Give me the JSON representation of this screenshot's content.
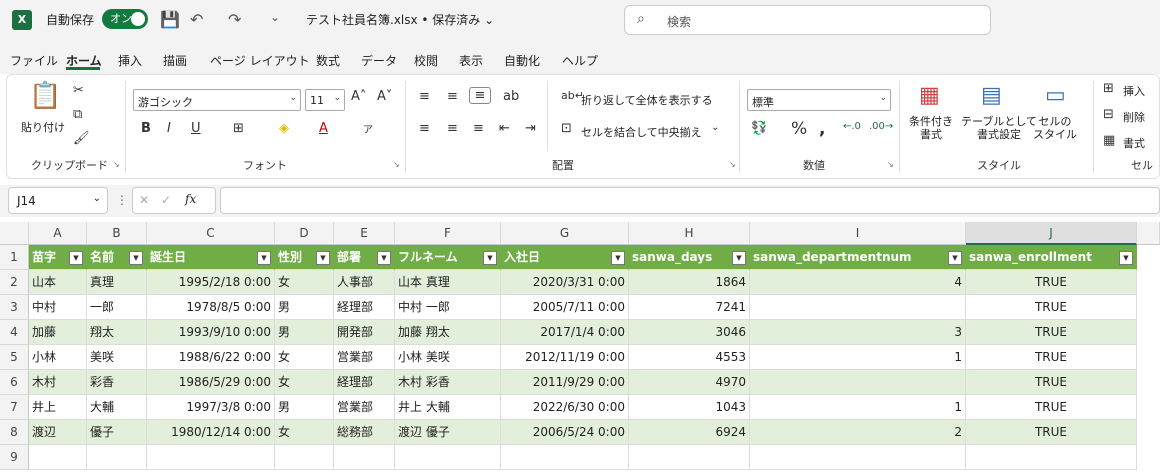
{
  "window": {
    "autosave_label": "自動保存",
    "autosave_state": "オン",
    "filename": "テスト社員名簿.xlsx • 保存済み ⌄",
    "search_placeholder": "検索",
    "app_icon": "X"
  },
  "menu": [
    "ファイル",
    "ホーム",
    "挿入",
    "描画",
    "ページ レイアウト",
    "数式",
    "データ",
    "校閲",
    "表示",
    "自動化",
    "ヘルプ"
  ],
  "ribbon": {
    "clipboard": {
      "label": "クリップボード",
      "paste": "貼り付け"
    },
    "font": {
      "label": "フォント",
      "name": "游ゴシック",
      "size": "11"
    },
    "alignment": {
      "label": "配置",
      "wrap": "折り返して全体を表示する",
      "merge": "セルを結合して中央揃え"
    },
    "number": {
      "label": "数値",
      "format": "標準"
    },
    "styles": {
      "label": "スタイル",
      "conditional": "条件付き\n書式",
      "table": "テーブルとして\n書式設定",
      "cell_styles": "セルの\nスタイル"
    },
    "cells": {
      "label": "セル",
      "insert": "挿入",
      "delete": "削除",
      "format": "書式"
    }
  },
  "formula_bar": {
    "name_box": "J14",
    "fx": "fx",
    "value": ""
  },
  "columns": [
    "A",
    "B",
    "C",
    "D",
    "E",
    "F",
    "G",
    "H",
    "I",
    "J"
  ],
  "rows": [
    "1",
    "2",
    "3",
    "4",
    "5",
    "6",
    "7",
    "8",
    "9"
  ],
  "headers": [
    "苗字",
    "名前",
    "誕生日",
    "性別",
    "部署",
    "フルネーム",
    "入社日",
    "sanwa_days",
    "sanwa_departmentnum",
    "sanwa_enrollment"
  ],
  "table": [
    [
      "山本",
      "真理",
      "1995/2/18 0:00",
      "女",
      "人事部",
      "山本 真理",
      "2020/3/31 0:00",
      "1864",
      "4",
      "TRUE"
    ],
    [
      "中村",
      "一郎",
      "1978/8/5 0:00",
      "男",
      "経理部",
      "中村 一郎",
      "2005/7/11 0:00",
      "7241",
      "",
      "TRUE"
    ],
    [
      "加藤",
      "翔太",
      "1993/9/10 0:00",
      "男",
      "開発部",
      "加藤 翔太",
      "2017/1/4 0:00",
      "3046",
      "3",
      "TRUE"
    ],
    [
      "小林",
      "美咲",
      "1988/6/22 0:00",
      "女",
      "営業部",
      "小林 美咲",
      "2012/11/19 0:00",
      "4553",
      "1",
      "TRUE"
    ],
    [
      "木村",
      "彩香",
      "1986/5/29 0:00",
      "女",
      "経理部",
      "木村 彩香",
      "2011/9/29 0:00",
      "4970",
      "",
      "TRUE"
    ],
    [
      "井上",
      "大輔",
      "1997/3/8 0:00",
      "男",
      "営業部",
      "井上 大輔",
      "2022/6/30 0:00",
      "1043",
      "1",
      "TRUE"
    ],
    [
      "渡辺",
      "優子",
      "1980/12/14 0:00",
      "女",
      "総務部",
      "渡辺 優子",
      "2006/5/24 0:00",
      "6924",
      "2",
      "TRUE"
    ]
  ],
  "colors": {
    "accent": "#1d6f42",
    "table_header": "#70ad47",
    "band": "#e2efda"
  }
}
